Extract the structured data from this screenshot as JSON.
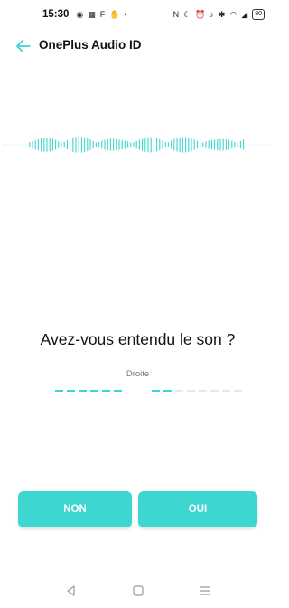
{
  "status_bar": {
    "time": "15:30",
    "battery": "80",
    "left_icons": [
      "messenger-icon",
      "qr-icon",
      "flipboard-icon",
      "hand-icon",
      "dot-icon"
    ],
    "right_icons": [
      "nfc-icon",
      "moon-icon",
      "alarm-icon",
      "vibrate-icon",
      "bluetooth-icon",
      "wifi-icon",
      "signal-icon"
    ]
  },
  "app_bar": {
    "title": "OnePlus Audio ID"
  },
  "main": {
    "question": "Avez-vous entendu le son ?",
    "side_label": "Droite",
    "progress": {
      "completed": 8,
      "total": 14
    }
  },
  "buttons": {
    "no_label": "NON",
    "yes_label": "OUI"
  },
  "colors": {
    "accent": "#3dd6d0",
    "dash_inactive": "#d8eeee"
  }
}
